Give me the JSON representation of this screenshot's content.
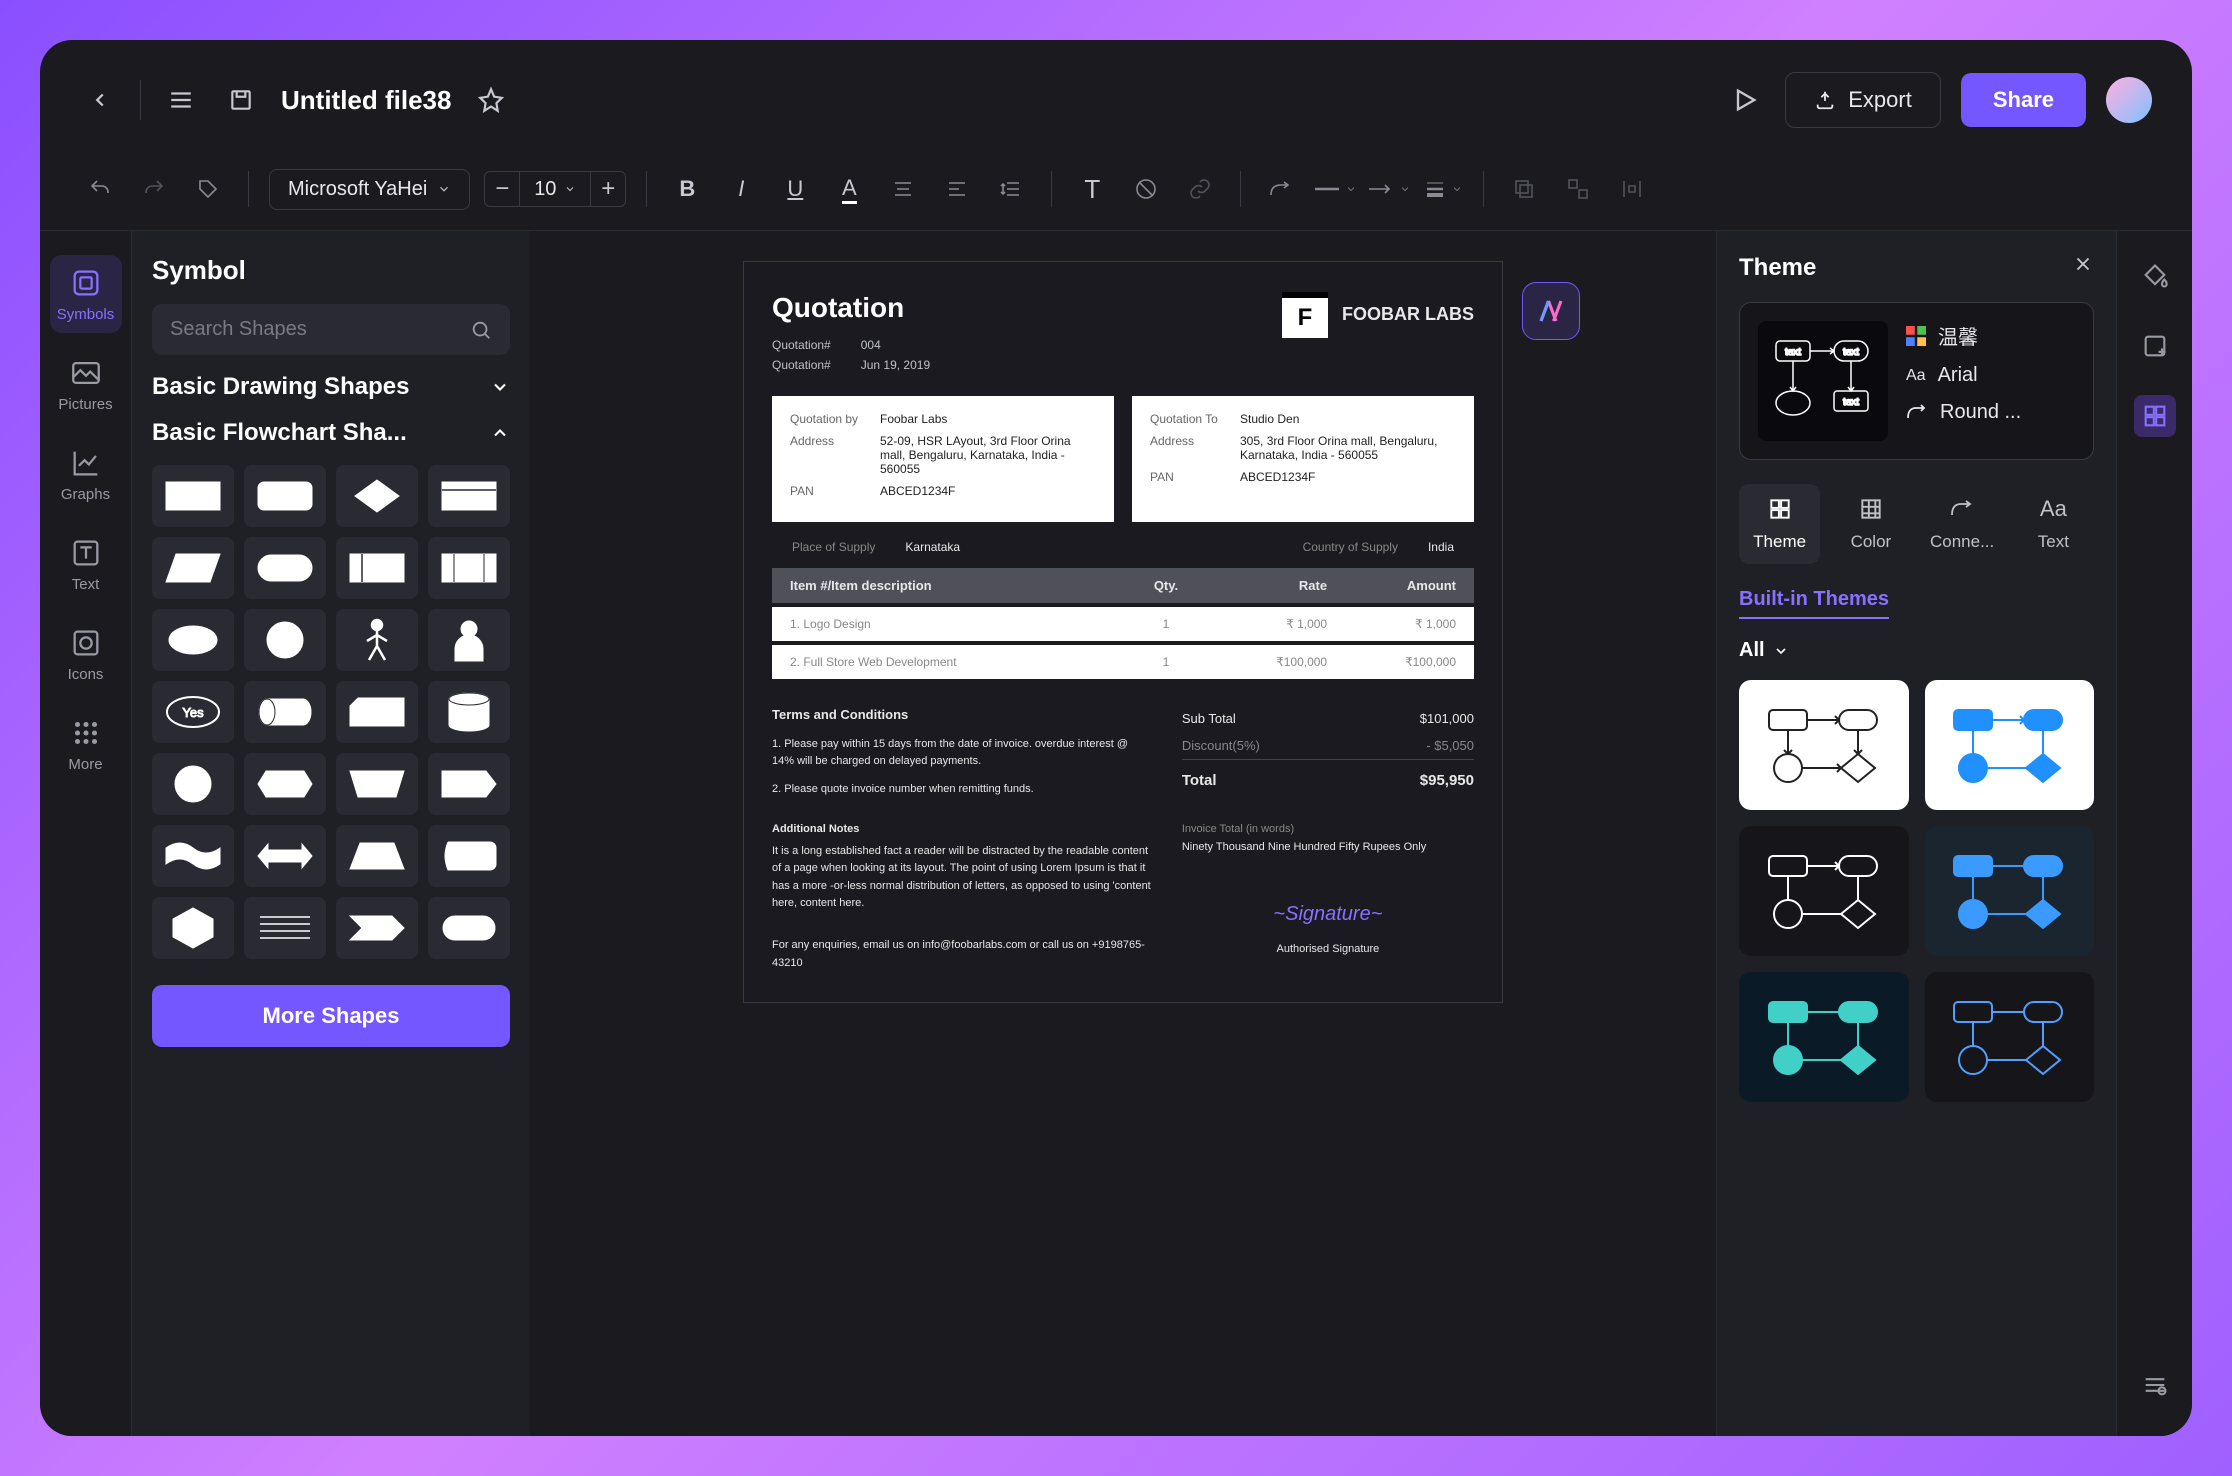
{
  "header": {
    "file_title": "Untitled file38",
    "export_label": "Export",
    "share_label": "Share"
  },
  "toolbar": {
    "font_family": "Microsoft YaHei",
    "font_size": "10"
  },
  "left_rail": [
    {
      "id": "symbols",
      "label": "Symbols"
    },
    {
      "id": "pictures",
      "label": "Pictures"
    },
    {
      "id": "graphs",
      "label": "Graphs"
    },
    {
      "id": "text",
      "label": "Text"
    },
    {
      "id": "icons",
      "label": "Icons"
    },
    {
      "id": "more",
      "label": "More"
    }
  ],
  "shapes_panel": {
    "title": "Symbol",
    "search_placeholder": "Search Shapes",
    "cat_basic_drawing": "Basic Drawing Shapes",
    "cat_basic_flowchart": "Basic Flowchart Sha...",
    "more_shapes_label": "More Shapes",
    "yes_label": "Yes"
  },
  "document": {
    "title": "Quotation",
    "company": "FOOBAR LABS",
    "meta": {
      "quotation_no_lbl": "Quotation#",
      "quotation_no": "004",
      "quotation_date_lbl": "Quotation#",
      "quotation_date": "Jun 19, 2019"
    },
    "from": {
      "by_lbl": "Quotation by",
      "by": "Foobar Labs",
      "addr_lbl": "Address",
      "addr": "52-09, HSR LAyout, 3rd Floor Orina mall, Bengaluru, Karnataka, India - 560055",
      "pan_lbl": "PAN",
      "pan": "ABCED1234F"
    },
    "to": {
      "to_lbl": "Quotation To",
      "to": "Studio Den",
      "addr_lbl": "Address",
      "addr": "305, 3rd Floor Orina mall, Bengaluru, Karnataka, India - 560055",
      "pan_lbl": "PAN",
      "pan": "ABCED1234F"
    },
    "supply": {
      "place_lbl": "Place of Supply",
      "place": "Karnataka",
      "country_lbl": "Country of Supply",
      "country": "India"
    },
    "table": {
      "h_item": "Item #/Item description",
      "h_qty": "Qty.",
      "h_rate": "Rate",
      "h_amt": "Amount",
      "rows": [
        {
          "item": "1. Logo Design",
          "qty": "1",
          "rate": "₹ 1,000",
          "amt": "₹ 1,000"
        },
        {
          "item": "2. Full Store Web Development",
          "qty": "1",
          "rate": "₹100,000",
          "amt": "₹100,000"
        }
      ]
    },
    "terms_title": "Terms and Conditions",
    "terms_1": "1.  Please pay within 15 days from the date of invoice. overdue interest @ 14% will be charged on delayed payments.",
    "terms_2": "2.  Please quote invoice number when remitting funds.",
    "totals": {
      "subtotal_lbl": "Sub Total",
      "subtotal": "$101,000",
      "discount_lbl": "Discount(5%)",
      "discount": "- $5,050",
      "total_lbl": "Total",
      "total": "$95,950"
    },
    "notes_title": "Additional Notes",
    "notes_body": "It is a long established fact a reader will be distracted by the readable content of a page when looking at its layout. The point of using Lorem Ipsum is that it has a more -or-less normal distribution of letters, as opposed to using 'content here, content here.",
    "invoice_words_lbl": "Invoice Total (in words)",
    "invoice_words": "Ninety Thousand Nine Hundred Fifty Rupees Only",
    "contact": "For any enquiries, email us on info@foobarlabs.com or call us on +9198765-43210",
    "sig_label": "Authorised Signature"
  },
  "theme_panel": {
    "title": "Theme",
    "preview_name": "温馨",
    "preview_font": "Arial",
    "preview_conn": "Round ...",
    "tabs": [
      {
        "id": "theme",
        "label": "Theme"
      },
      {
        "id": "color",
        "label": "Color"
      },
      {
        "id": "conn",
        "label": "Conne..."
      },
      {
        "id": "text",
        "label": "Text"
      }
    ],
    "built_in_label": "Built-in Themes",
    "all_label": "All"
  }
}
